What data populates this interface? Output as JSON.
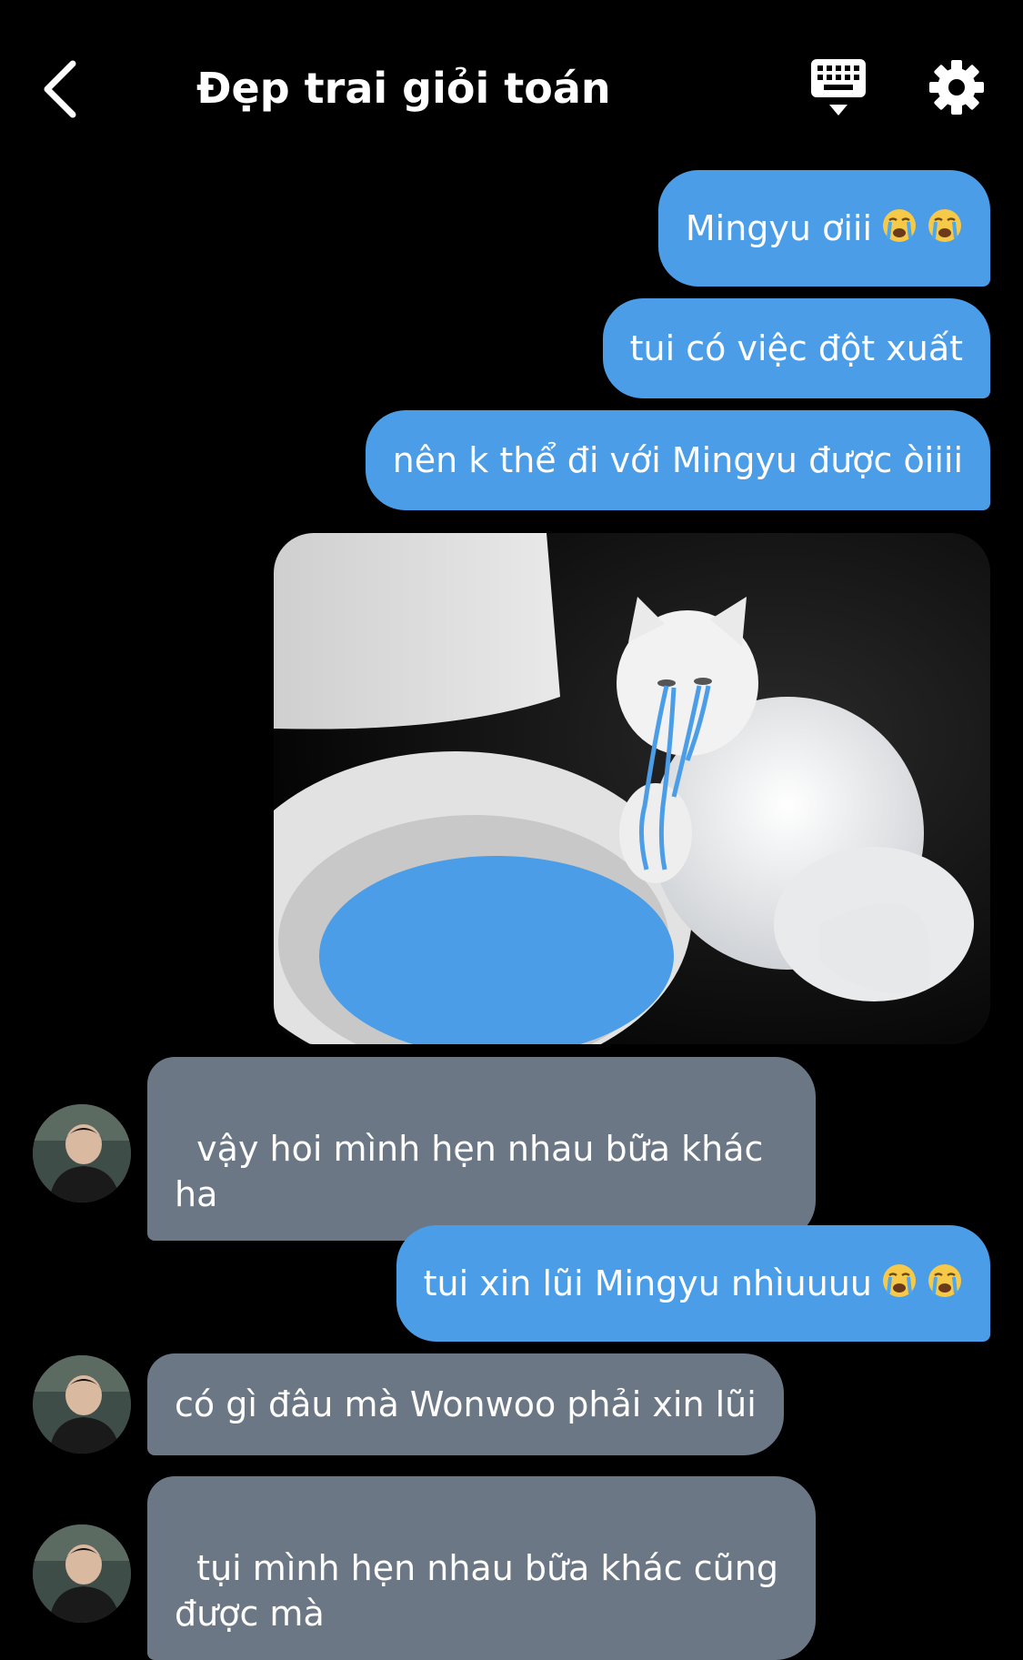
{
  "header": {
    "title": "Đẹp trai giỏi toán"
  },
  "messages": [
    {
      "side": "out",
      "text": "Mingyu ơiii",
      "emoji": [
        "crying-face",
        "crying-face"
      ]
    },
    {
      "side": "out",
      "text": "tui có việc đột xuất"
    },
    {
      "side": "out",
      "text": "nên k thể đi với Mingyu được òiiii"
    },
    {
      "side": "out",
      "type": "image",
      "subject": "white cat crying next to toilet with blue tears"
    },
    {
      "side": "in",
      "text": "vậy hoi mình hẹn nhau bữa khác\nha"
    },
    {
      "side": "out",
      "text": "tui xin lũi Mingyu nhìuuuu",
      "emoji": [
        "crying-face",
        "crying-face"
      ]
    },
    {
      "side": "in",
      "text": "có gì đâu mà Wonwoo phải xin lũi"
    },
    {
      "side": "in",
      "text": "tụi mình hẹn nhau bữa khác cũng\nđược mà"
    }
  ],
  "colors": {
    "background": "#000000",
    "outgoing_bubble": "#4a9de6",
    "incoming_bubble": "#6b7785",
    "text": "#ffffff"
  }
}
